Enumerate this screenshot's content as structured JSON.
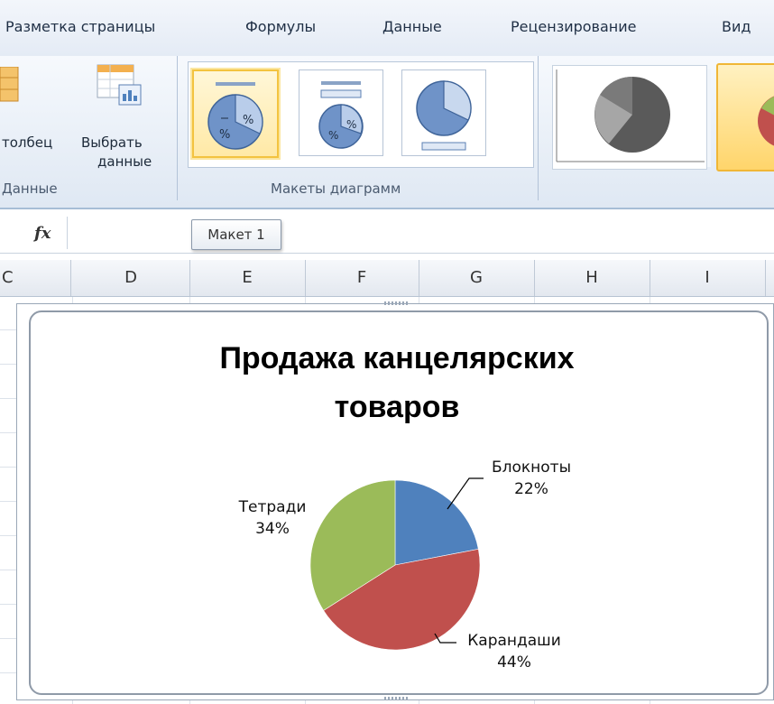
{
  "ribbon_tabs": [
    "Разметка страницы",
    "Формулы",
    "Данные",
    "Рецензирование",
    "Вид"
  ],
  "ribbon": {
    "data_group": {
      "switch_label": "толбец",
      "select_data_line1": "Выбрать",
      "select_data_line2": "данные",
      "group_label": "Данные"
    },
    "layouts_group": {
      "group_label": "Макеты диаграмм"
    }
  },
  "formula_bar": {
    "fx_label": "fx",
    "value": ""
  },
  "tooltip": "Макет 1",
  "columns": [
    "C",
    "D",
    "E",
    "F",
    "G",
    "H",
    "I"
  ],
  "colors": {
    "blue": "#4f81bd",
    "red": "#c0504d",
    "green": "#9bbb59",
    "selection": "#f3c33f"
  },
  "chart_data": {
    "type": "pie",
    "title_line1": "Продажа канцелярских",
    "title_line2": "товаров",
    "slices": [
      {
        "name": "Блокноты",
        "percent_label": "22%",
        "value": 22,
        "color": "#4f81bd"
      },
      {
        "name": "Карандаши",
        "percent_label": "44%",
        "value": 44,
        "color": "#c0504d"
      },
      {
        "name": "Тетради",
        "percent_label": "34%",
        "value": 34,
        "color": "#9bbb59"
      }
    ]
  }
}
